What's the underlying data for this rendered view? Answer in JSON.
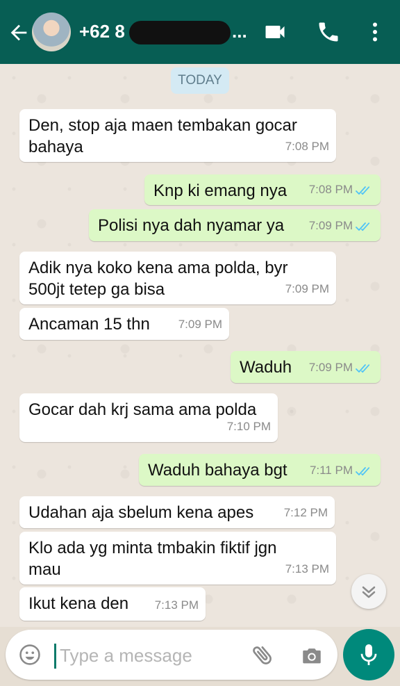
{
  "header": {
    "contact_prefix": "+62 8",
    "ellipsis": "...",
    "icons": [
      "back-arrow-icon",
      "video-call-icon",
      "phone-icon",
      "more-vert-icon"
    ],
    "color": "#075e54"
  },
  "chat": {
    "date_chip": "TODAY",
    "messages": [
      {
        "dir": "in",
        "text": "Den, stop aja maen tembakan gocar\nbahaya",
        "time": "7:08 PM"
      },
      {
        "dir": "out",
        "text": "Knp ki emang nya",
        "time": "7:08 PM",
        "status": "read"
      },
      {
        "dir": "out",
        "text": "Polisi nya dah nyamar ya",
        "time": "7:09 PM",
        "status": "read"
      },
      {
        "dir": "in",
        "text": "Adik nya koko kena ama polda, byr\n500jt tetep ga bisa",
        "time": "7:09 PM"
      },
      {
        "dir": "in",
        "text": "Ancaman 15 thn",
        "time": "7:09 PM"
      },
      {
        "dir": "out",
        "text": "Waduh",
        "time": "7:09 PM",
        "status": "read"
      },
      {
        "dir": "in",
        "text": "Gocar dah krj sama ama polda",
        "time": "7:10 PM"
      },
      {
        "dir": "out",
        "text": "Waduh bahaya bgt",
        "time": "7:11 PM",
        "status": "read"
      },
      {
        "dir": "in",
        "text": "Udahan aja sbelum kena apes",
        "time": "7:12 PM"
      },
      {
        "dir": "in",
        "text": "Klo ada yg minta tmbakin fiktif jgn\nmau",
        "time": "7:13 PM"
      },
      {
        "dir": "in",
        "text": "Ikut kena den",
        "time": "7:13 PM"
      }
    ],
    "read_tick_color": "#4fc3f7"
  },
  "composer": {
    "placeholder": "Type a message",
    "icons": [
      "emoji-icon",
      "attach-icon",
      "camera-icon",
      "mic-icon"
    ]
  }
}
